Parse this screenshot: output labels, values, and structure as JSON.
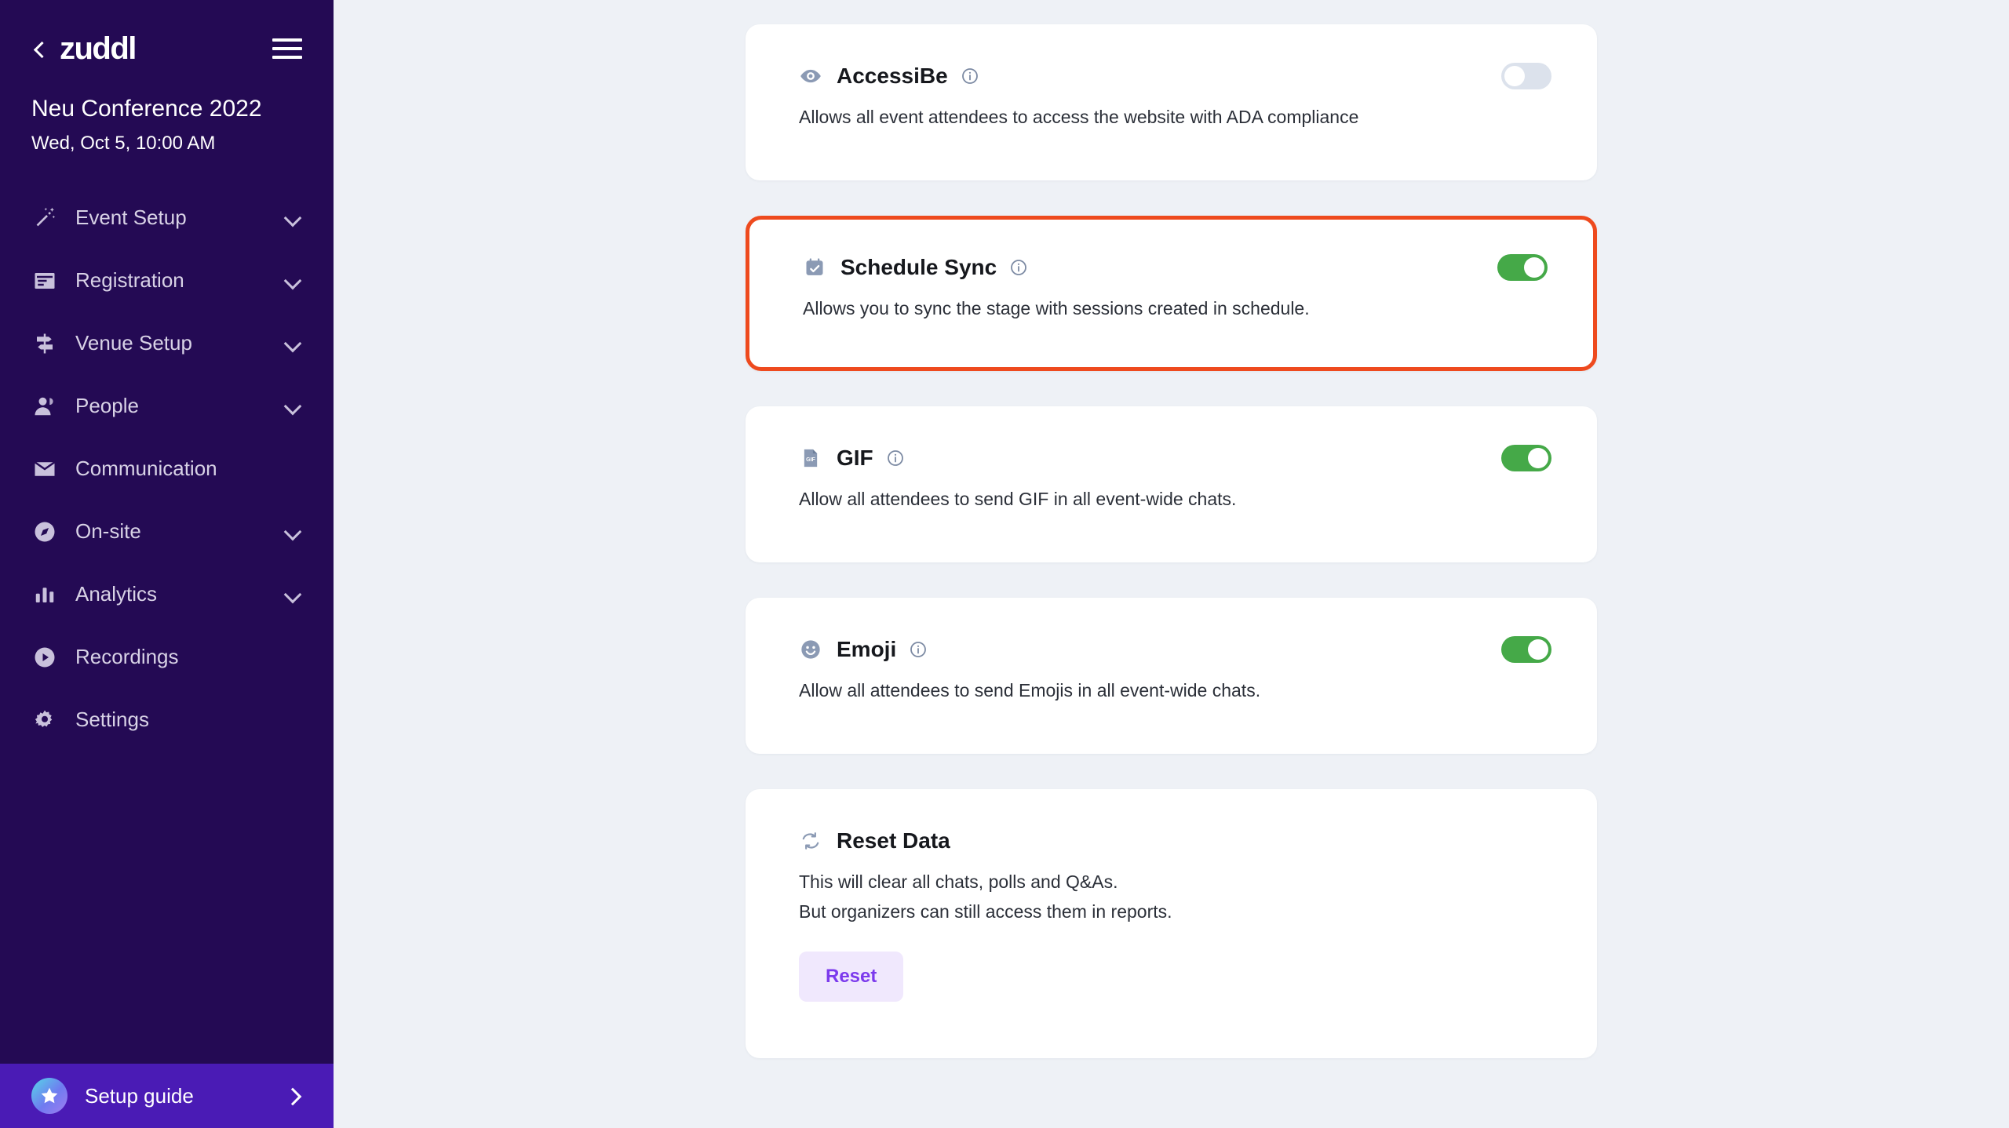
{
  "sidebar": {
    "back_icon": "chevron-left-icon",
    "logo_text": "zuddl",
    "menu_icon": "hamburger-menu-icon",
    "event_name": "Neu Conference 2022",
    "event_date": "Wed, Oct 5, 10:00 AM",
    "items": [
      {
        "label": "Event Setup",
        "icon": "magic-wand-icon",
        "expandable": true
      },
      {
        "label": "Registration",
        "icon": "form-card-icon",
        "expandable": true
      },
      {
        "label": "Venue Setup",
        "icon": "signpost-icon",
        "expandable": true
      },
      {
        "label": "People",
        "icon": "person-icon",
        "expandable": true
      },
      {
        "label": "Communication",
        "icon": "envelope-icon",
        "expandable": false
      },
      {
        "label": "On-site",
        "icon": "compass-icon",
        "expandable": true
      },
      {
        "label": "Analytics",
        "icon": "bar-chart-icon",
        "expandable": true
      },
      {
        "label": "Recordings",
        "icon": "play-circle-icon",
        "expandable": false
      },
      {
        "label": "Settings",
        "icon": "gear-icon",
        "expandable": false
      }
    ],
    "setup_guide": {
      "label": "Setup guide",
      "icon": "star-badge-icon",
      "chevron": "chevron-right-icon"
    }
  },
  "main": {
    "cards": [
      {
        "id": "accessibe",
        "icon": "eye-icon",
        "title": "AccessiBe",
        "info_icon": "info-circle-icon",
        "description": "Allows all event attendees to access the website with ADA compliance",
        "toggle_state": "off",
        "highlighted": false
      },
      {
        "id": "schedule-sync",
        "icon": "calendar-check-icon",
        "title": "Schedule Sync",
        "info_icon": "info-circle-icon",
        "description": "Allows you to sync the stage with sessions created in schedule.",
        "toggle_state": "on",
        "highlighted": true
      },
      {
        "id": "gif",
        "icon": "gif-file-icon",
        "title": "GIF",
        "info_icon": "info-circle-icon",
        "description": "Allow all attendees to send GIF in all event-wide chats.",
        "toggle_state": "on",
        "highlighted": false
      },
      {
        "id": "emoji",
        "icon": "smiley-face-icon",
        "title": "Emoji",
        "info_icon": "info-circle-icon",
        "description": "Allow all attendees to send Emojis in all event-wide chats.",
        "toggle_state": "on",
        "highlighted": false
      }
    ],
    "reset_card": {
      "id": "reset-data",
      "icon": "refresh-icon",
      "title": "Reset Data",
      "description_line1": "This will clear all chats, polls and Q&As.",
      "description_line2": "But organizers can still access them in reports.",
      "button_label": "Reset"
    }
  },
  "colors": {
    "sidebar_bg": "#240a54",
    "setup_guide_bg": "#4a1bb5",
    "page_bg": "#eef1f6",
    "card_bg": "#ffffff",
    "highlight_border": "#ee4a1e",
    "toggle_on": "#45a948",
    "toggle_off": "#dce2ec",
    "reset_button_bg": "#f0e8fd",
    "reset_button_text": "#7c3aed",
    "icon_slate": "#8b9ab4"
  }
}
